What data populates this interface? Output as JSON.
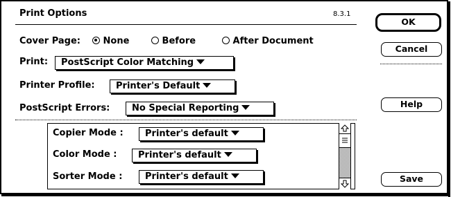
{
  "dialog": {
    "title": "Print Options",
    "version": "8.3.1"
  },
  "buttons": {
    "ok": "OK",
    "cancel": "Cancel",
    "help": "Help",
    "save": "Save"
  },
  "cover_page": {
    "label": "Cover Page:",
    "options": [
      "None",
      "Before",
      "After Document"
    ],
    "selected": "None"
  },
  "print": {
    "label": "Print:",
    "value": "PostScript Color Matching"
  },
  "printer_profile": {
    "label": "Printer Profile:",
    "value": "Printer's Default"
  },
  "postscript_errors": {
    "label": "PostScript Errors:",
    "value": "No Special Reporting"
  },
  "device_options": [
    {
      "label": "Copier Mode  :",
      "value": "Printer's default"
    },
    {
      "label": "Color Mode  :",
      "value": "Printer's default"
    },
    {
      "label": "Sorter Mode  :",
      "value": "Printer's default"
    }
  ],
  "scrollbar": {
    "up_icon": "arrow-up-icon",
    "down_icon": "arrow-down-icon",
    "thumb_icon": "grip-icon"
  }
}
